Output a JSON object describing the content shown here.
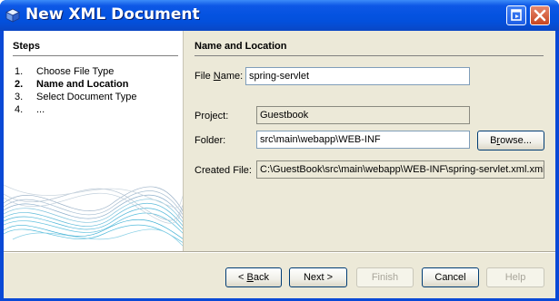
{
  "window": {
    "title": "New XML Document",
    "icon": "cube-icon"
  },
  "steps": {
    "heading": "Steps",
    "items": [
      {
        "num": "1.",
        "label": "Choose File Type"
      },
      {
        "num": "2.",
        "label": "Name and Location"
      },
      {
        "num": "3.",
        "label": "Select Document Type"
      },
      {
        "num": "4.",
        "label": "..."
      }
    ],
    "active_index": 1
  },
  "form": {
    "heading": "Name and Location",
    "file_name_label_pre": "File ",
    "file_name_label_mnemonic": "N",
    "file_name_label_post": "ame:",
    "file_name_value": "spring-servlet",
    "project_label": "Project:",
    "project_value": "Guestbook",
    "folder_label": "Folder:",
    "folder_value": "src\\main\\webapp\\WEB-INF",
    "browse_label_pre": "B",
    "browse_label_mnemonic": "r",
    "browse_label_post": "owse...",
    "created_file_label": "Created File:",
    "created_file_value": "C:\\GuestBook\\src\\main\\webapp\\WEB-INF\\spring-servlet.xml.xml"
  },
  "footer": {
    "back_prefix": "< ",
    "back_mnemonic": "B",
    "back_suffix": "ack",
    "next_label": "Next >",
    "finish_label": "Finish",
    "cancel_label": "Cancel",
    "help_label": "Help"
  },
  "colors": {
    "titlebar": "#0553e1",
    "dialog_bg": "#ece9d8",
    "accent_wave": "#4fb6d8"
  }
}
